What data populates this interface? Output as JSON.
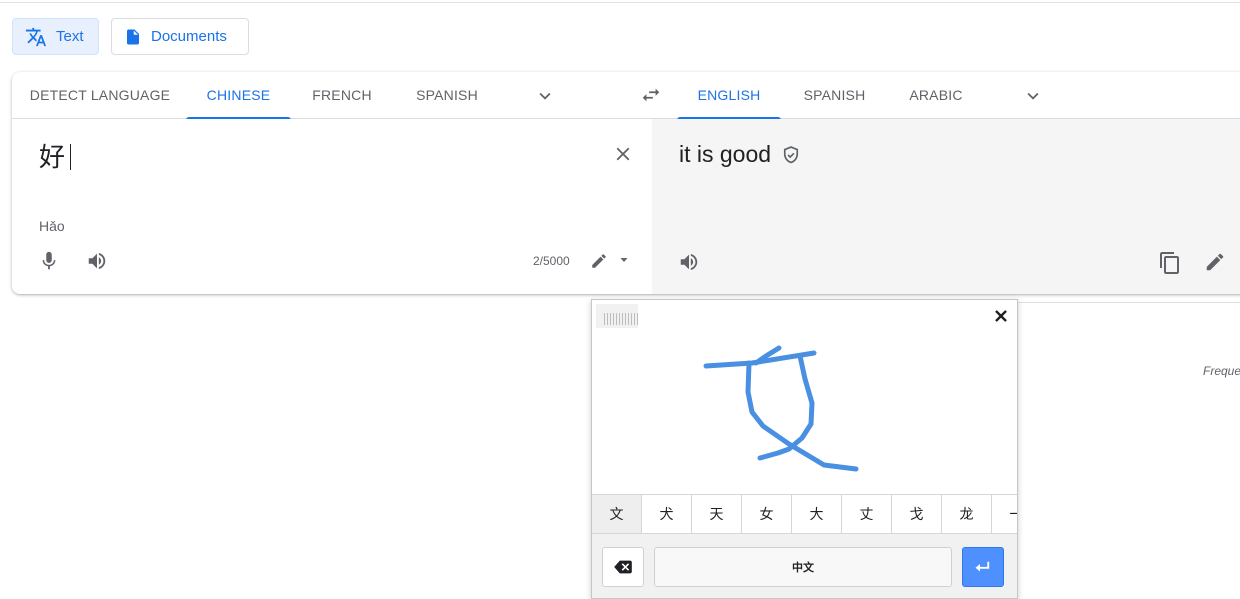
{
  "mode_buttons": {
    "text": "Text",
    "documents": "Documents"
  },
  "source_languages": [
    "DETECT LANGUAGE",
    "CHINESE",
    "FRENCH",
    "SPANISH"
  ],
  "target_languages": [
    "ENGLISH",
    "SPANISH",
    "ARABIC"
  ],
  "active_source": "CHINESE",
  "active_target": "ENGLISH",
  "source": {
    "text": "好",
    "transliteration": "Hǎo",
    "char_count": "2/5000"
  },
  "target": {
    "text": "it is good"
  },
  "side_text": {
    "frequency": "Freque"
  },
  "handwriting": {
    "candidates": [
      "文",
      "犬",
      "天",
      "女",
      "大",
      "丈",
      "戈",
      "龙",
      "一"
    ],
    "space_key": "中文"
  },
  "colors": {
    "accent": "#1a73e8",
    "ink": "#4a90e2",
    "enter": "#4d90fe"
  },
  "icons": [
    "translate-icon",
    "document-icon",
    "chevron-down-icon",
    "swap-icon",
    "close-icon",
    "mic-icon",
    "speaker-icon",
    "pencil-icon",
    "verified-shield-icon",
    "copy-icon",
    "backspace-icon",
    "enter-icon"
  ]
}
